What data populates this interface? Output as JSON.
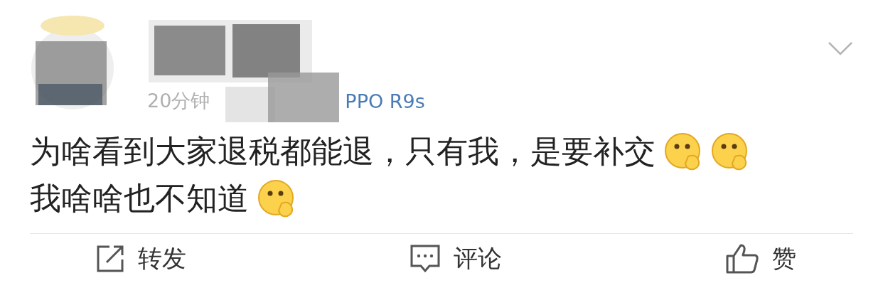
{
  "post": {
    "time": "20分钟",
    "source": "PPO R9s",
    "lines": [
      [
        {
          "kind": "text",
          "text": "为啥看到大家退税都能退，只有我，是要补交"
        },
        {
          "kind": "emoji"
        },
        {
          "kind": "emoji"
        }
      ],
      [
        {
          "kind": "text",
          "text": "我啥啥也不知道"
        },
        {
          "kind": "emoji"
        }
      ]
    ]
  },
  "actions": [
    {
      "kind": "repost",
      "label": "转发"
    },
    {
      "kind": "comment",
      "label": "评论"
    },
    {
      "kind": "like",
      "label": "赞"
    }
  ]
}
